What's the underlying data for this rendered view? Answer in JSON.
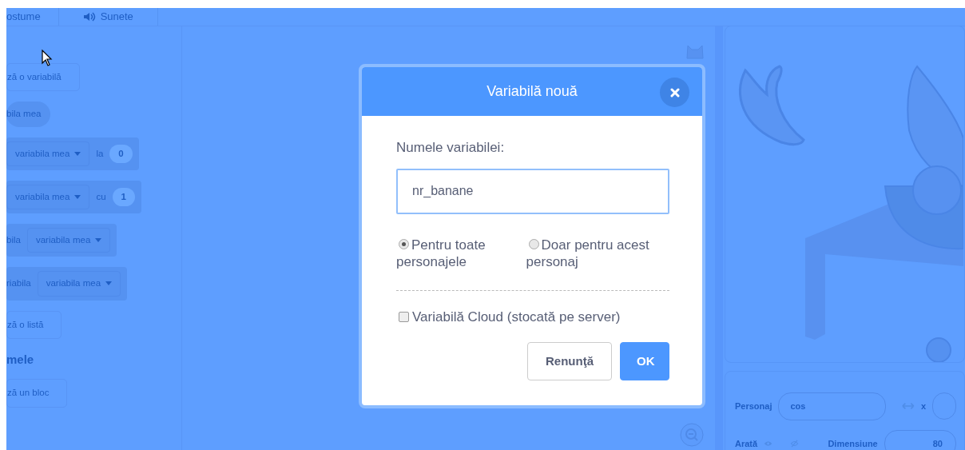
{
  "editor_tabs": [
    {
      "label": "ostume",
      "selected": false
    },
    {
      "label": "Sunete",
      "selected": false
    }
  ],
  "palette": [
    {
      "kind": "button",
      "text": "ză o variabilă"
    },
    {
      "kind": "reporter",
      "text": "bila mea"
    },
    {
      "kind": "block",
      "parts": [
        {
          "kind": "dropdown",
          "text": "variabila mea"
        },
        {
          "kind": "label",
          "text": "la"
        },
        {
          "kind": "number",
          "text": "0"
        }
      ]
    },
    {
      "kind": "block",
      "parts": [
        {
          "kind": "dropdown",
          "text": "variabila mea"
        },
        {
          "kind": "label",
          "text": "cu"
        },
        {
          "kind": "number",
          "text": "1"
        }
      ]
    },
    {
      "kind": "block",
      "parts": [
        {
          "kind": "label",
          "text": "bila"
        },
        {
          "kind": "dropdown",
          "text": "variabila mea"
        }
      ]
    },
    {
      "kind": "block",
      "parts": [
        {
          "kind": "label",
          "text": "riabila"
        },
        {
          "kind": "dropdown",
          "text": "variabila mea"
        }
      ]
    },
    {
      "kind": "button",
      "text": "ză o listă"
    },
    {
      "kind": "heading",
      "text": "mele"
    },
    {
      "kind": "button",
      "text": "ză un bloc"
    }
  ],
  "sprite_info": {
    "sprite_label": "Personaj",
    "sprite_name": "cos",
    "x_label": "x",
    "show_label": "Arată",
    "size_label": "Dimensiune",
    "size_value": "80"
  },
  "dialog": {
    "title": "Variabilă nouă",
    "name_label": "Numele variabilei:",
    "name_value": "nr_banane",
    "scope_options": [
      {
        "label": "Pentru toate personajele",
        "selected": true
      },
      {
        "label": "Doar pentru acest personaj",
        "selected": false
      }
    ],
    "cloud": {
      "label": "Variabilă Cloud (stocată pe server)",
      "checked": false
    },
    "buttons": [
      {
        "kind": "secondary",
        "label": "Renunţă"
      },
      {
        "kind": "primary",
        "label": "OK"
      }
    ]
  }
}
